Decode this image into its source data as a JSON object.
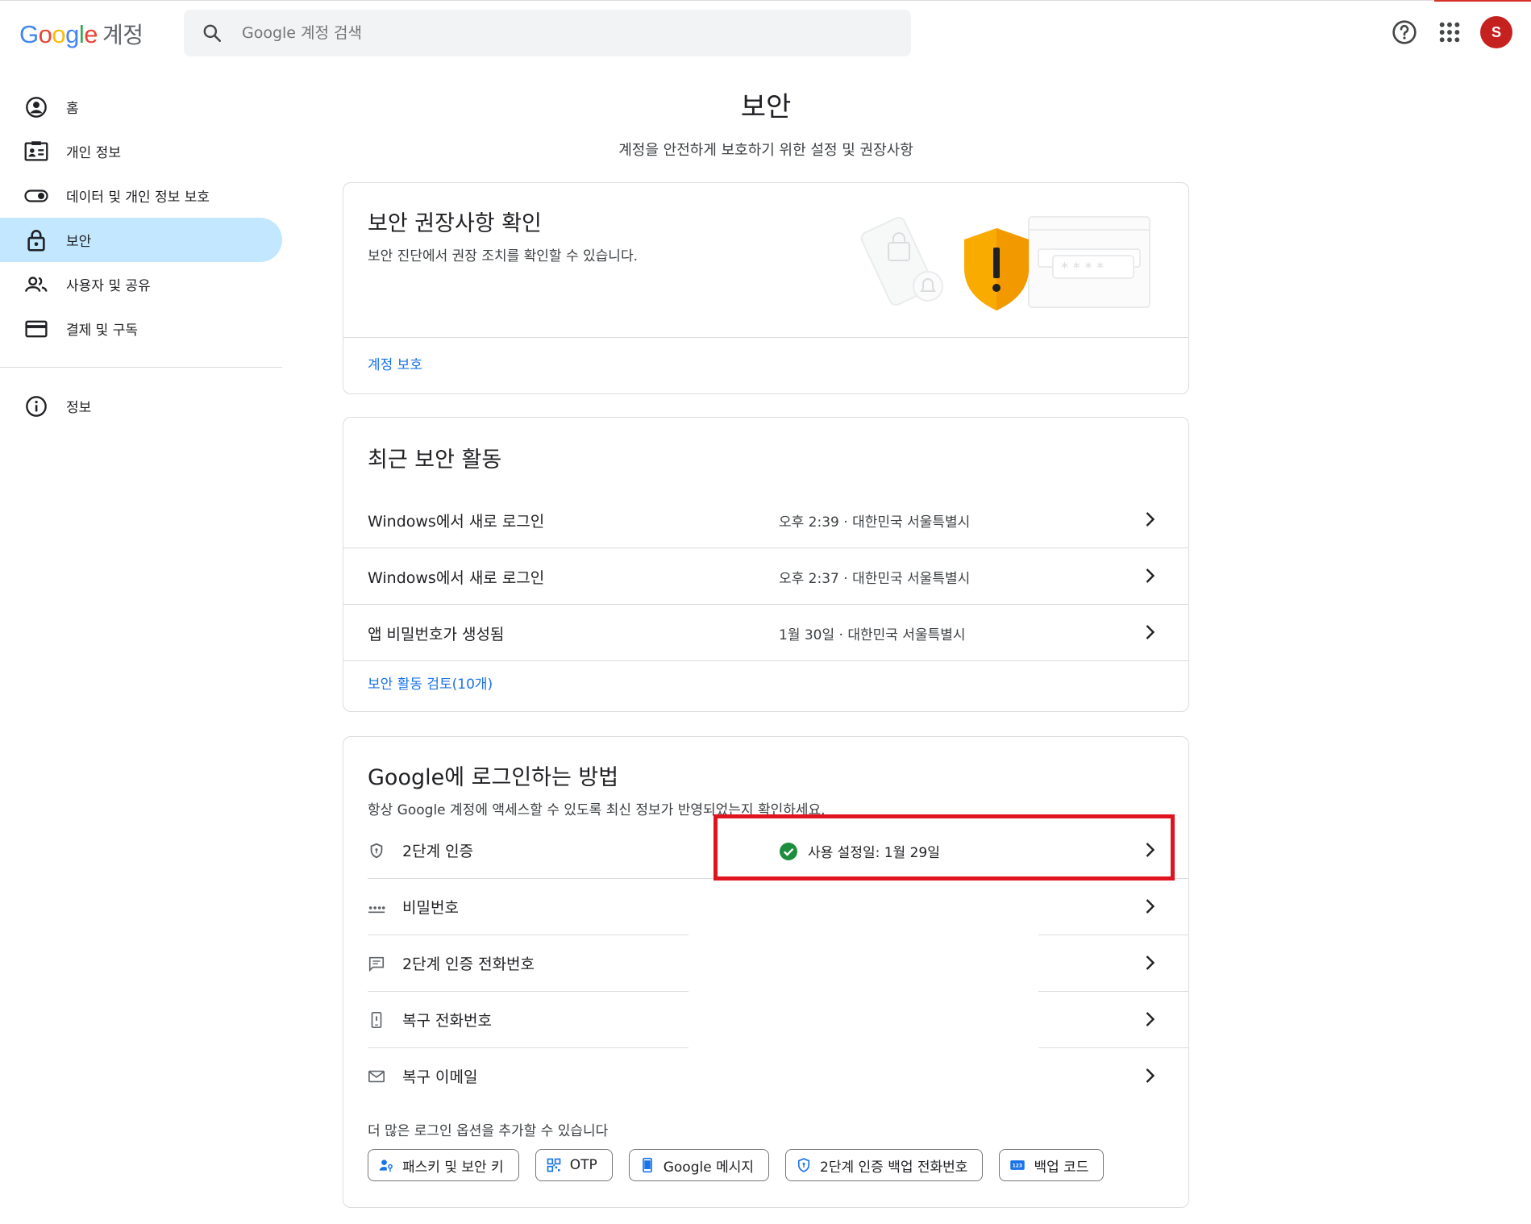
{
  "header": {
    "logo_google": "Google",
    "logo_sub": "계정",
    "search_placeholder": "Google 계정 검색",
    "avatar_letter": "S"
  },
  "sidebar": {
    "items": [
      {
        "label": "홈",
        "icon": "account-circle-icon"
      },
      {
        "label": "개인 정보",
        "icon": "id-card-icon"
      },
      {
        "label": "데이터 및 개인 정보 보호",
        "icon": "toggle-icon"
      },
      {
        "label": "보안",
        "icon": "lock-icon",
        "active": true
      },
      {
        "label": "사용자 및 공유",
        "icon": "people-icon"
      },
      {
        "label": "결제 및 구독",
        "icon": "credit-card-icon"
      },
      {
        "label": "정보",
        "icon": "info-icon"
      }
    ]
  },
  "page": {
    "title": "보안",
    "subtitle": "계정을 안전하게 보호하기 위한 설정 및 권장사항"
  },
  "recommendations": {
    "title": "보안 권장사항 확인",
    "description": "보안 진단에서 권장 조치를 확인할 수 있습니다.",
    "link": "계정 보호"
  },
  "recent_activity": {
    "title": "최근 보안 활동",
    "rows": [
      {
        "label": "Windows에서 새로 로그인",
        "meta": "오후 2:39 · 대한민국 서울특별시"
      },
      {
        "label": "Windows에서 새로 로그인",
        "meta": "오후 2:37 · 대한민국 서울특별시"
      },
      {
        "label": "앱 비밀번호가 생성됨",
        "meta": "1월 30일 · 대한민국 서울특별시"
      }
    ],
    "link": "보안 활동 검토(10개)"
  },
  "signin": {
    "title": "Google에 로그인하는 방법",
    "description": "항상 Google 계정에 액세스할 수 있도록 최신 정보가 반영되었는지 확인하세요.",
    "rows": [
      {
        "label": "2단계 인증",
        "icon": "shield-icon",
        "status": "사용 설정일: 1월 29일"
      },
      {
        "label": "비밀번호",
        "icon": "password-dots-icon",
        "status": ""
      },
      {
        "label": "2단계 인증 전화번호",
        "icon": "message-icon",
        "status": ""
      },
      {
        "label": "복구 전화번호",
        "icon": "phone-icon",
        "status": ""
      },
      {
        "label": "복구 이메일",
        "icon": "mail-icon",
        "status": ""
      }
    ],
    "more_label": "더 많은 로그인 옵션을 추가할 수 있습니다",
    "chips": [
      {
        "label": "패스키 및 보안 키",
        "icon": "passkey-icon"
      },
      {
        "label": "OTP",
        "icon": "qr-code-icon"
      },
      {
        "label": "Google 메시지",
        "icon": "smartphone-icon"
      },
      {
        "label": "2단계 인증 백업 전화번호",
        "icon": "shield-icon"
      },
      {
        "label": "백업 코드",
        "icon": "backup-code-icon"
      }
    ]
  },
  "colors": {
    "accent": "#1a73e8",
    "active_nav": "#c2e7ff",
    "success": "#1e8e3e",
    "warning": "#f9ab00",
    "highlight_box": "#e0141e",
    "avatar": "#c5221f"
  }
}
